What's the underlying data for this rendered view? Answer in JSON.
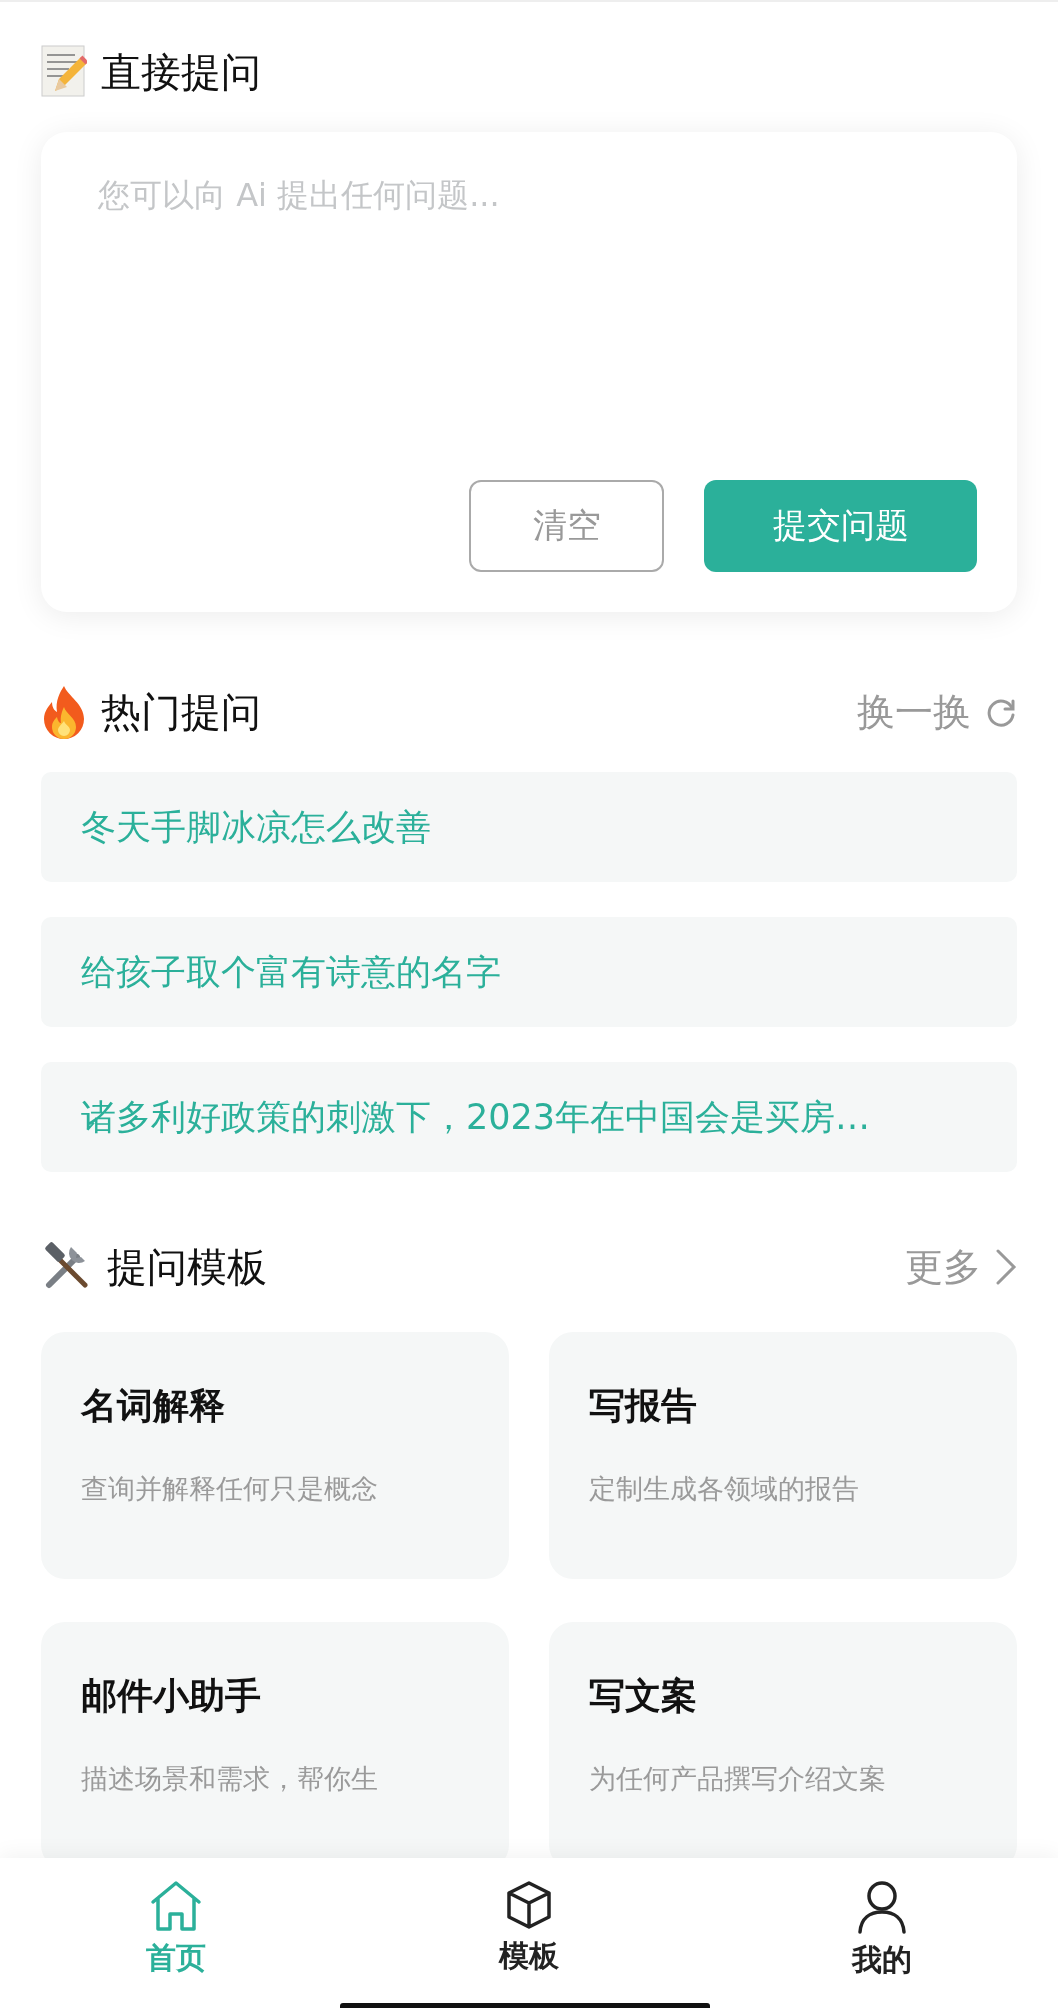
{
  "ask_section": {
    "title": "直接提问",
    "placeholder": "您可以向 Ai 提出任何问题...",
    "buttons": [
      {
        "kind": "outline",
        "label": "清空"
      },
      {
        "kind": "primary",
        "label": "提交问题"
      }
    ]
  },
  "hot_section": {
    "title": "热门提问",
    "action": "换一换",
    "items": [
      {
        "text": "冬天手脚冰凉怎么改善"
      },
      {
        "text": "给孩子取个富有诗意的名字"
      },
      {
        "text": "诸多利好政策的刺激下，2023年在中国会是买房…"
      }
    ]
  },
  "template_section": {
    "title": "提问模板",
    "action": "更多",
    "cards": [
      {
        "title": "名词解释",
        "description": "查询并解释任何只是概念"
      },
      {
        "title": "写报告",
        "description": "定制生成各领域的报告"
      },
      {
        "title": "邮件小助手",
        "description": "描述场景和需求，帮你生"
      },
      {
        "title": "写文案",
        "description": "为任何产品撰写介绍文案"
      }
    ]
  },
  "tab_bar": [
    {
      "kind": "home",
      "label": "首页",
      "selected": true
    },
    {
      "kind": "box",
      "label": "模板",
      "selected": false
    },
    {
      "kind": "user",
      "label": "我的",
      "selected": false
    }
  ]
}
